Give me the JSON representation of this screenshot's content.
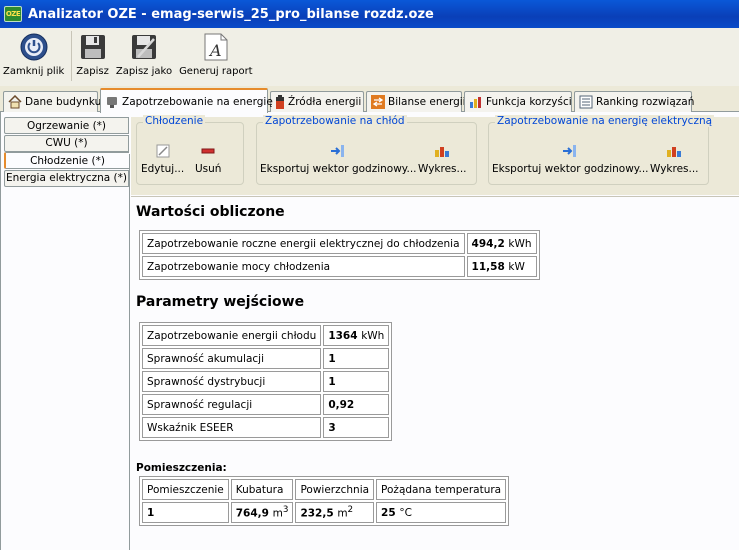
{
  "window": {
    "title": "Analizator OZE - emag-serwis_25_pro_bilanse rozdz.oze",
    "logo_text": "OZE"
  },
  "toolbar": {
    "close_file": "Zamknij plik",
    "save": "Zapisz",
    "save_as": "Zapisz jako",
    "generate_report": "Generuj raport"
  },
  "tabs": {
    "building": "Dane budynku",
    "demand": "Zapotrzebowanie na energię",
    "sources": "Źródła energii",
    "balance": "Bilanse energii",
    "benefit": "Funkcja korzyści",
    "ranking": "Ranking rozwiązań"
  },
  "side_tabs": {
    "heating": "Ogrzewanie (*)",
    "cwu": "CWU (*)",
    "cooling": "Chłodzenie (*)",
    "electric": "Energia elektryczna (*)"
  },
  "groups": {
    "cooling": {
      "title": "Chłodzenie",
      "edit": "Edytuj...",
      "delete": "Usuń"
    },
    "cold_demand": {
      "title": "Zapotrzebowanie na chłód",
      "export": "Eksportuj wektor godzinowy...",
      "chart": "Wykres..."
    },
    "electric_demand": {
      "title": "Zapotrzebowanie na energię elektryczną",
      "export": "Eksportuj wektor godzinowy...",
      "chart": "Wykres..."
    }
  },
  "computed": {
    "heading": "Wartości obliczone",
    "rows": [
      {
        "label": "Zapotrzebowanie roczne energii elektrycznej do chłodzenia",
        "value": "494,2",
        "unit": "kWh"
      },
      {
        "label": "Zapotrzebowanie mocy chłodzenia",
        "value": "11,58",
        "unit": "kW"
      }
    ]
  },
  "inputs": {
    "heading": "Parametry wejściowe",
    "rows": [
      {
        "label": "Zapotrzebowanie energii chłodu",
        "value": "1364",
        "unit": "kWh"
      },
      {
        "label": "Sprawność akumulacji",
        "value": "1",
        "unit": ""
      },
      {
        "label": "Sprawność dystrybucji",
        "value": "1",
        "unit": ""
      },
      {
        "label": "Sprawność regulacji",
        "value": "0,92",
        "unit": ""
      },
      {
        "label": "Wskaźnik ESEER",
        "value": "3",
        "unit": ""
      }
    ]
  },
  "rooms": {
    "heading": "Pomieszczenia:",
    "columns": [
      "Pomieszczenie",
      "Kubatura",
      "Powierzchnia",
      "Pożądana temperatura"
    ],
    "row": {
      "room": "1",
      "volume": "764,9",
      "volume_unit": "m",
      "volume_exp": "3",
      "area": "232,5",
      "area_unit": "m",
      "area_exp": "2",
      "temp": "25",
      "temp_unit": "°C"
    }
  }
}
